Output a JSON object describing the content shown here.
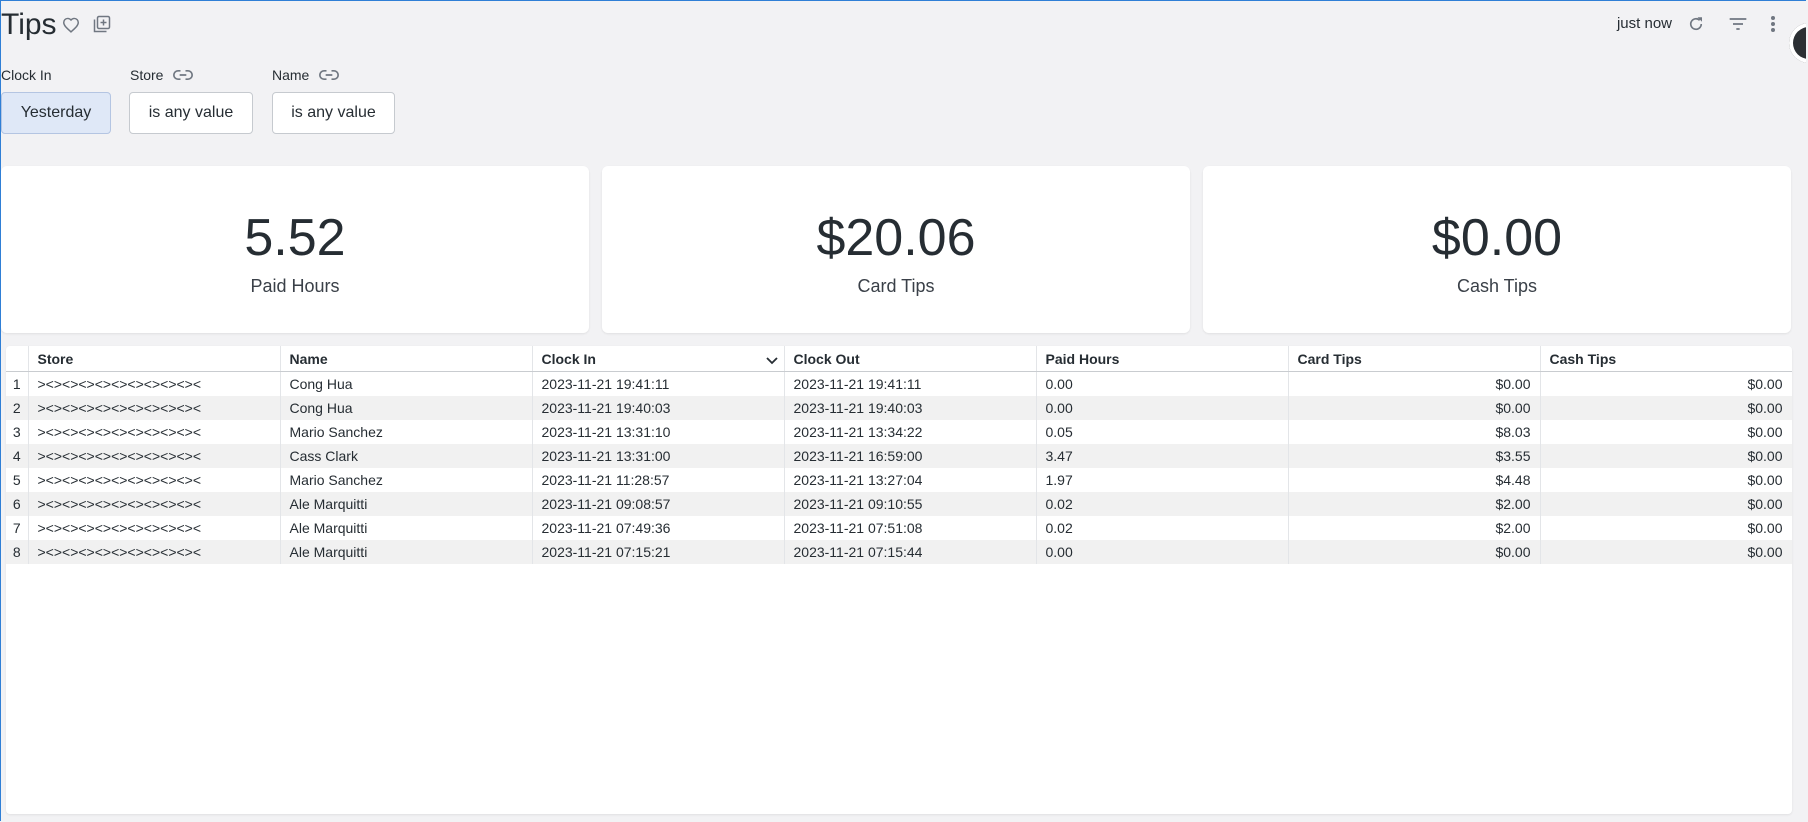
{
  "header": {
    "title": "Tips",
    "refresh_label": "just now",
    "icons": [
      "heart-icon",
      "add-to-board-icon",
      "refresh-icon",
      "filter-icon",
      "more-vert-icon"
    ]
  },
  "filters": [
    {
      "label": "Clock In",
      "value": "Yesterday",
      "linked": false
    },
    {
      "label": "Store",
      "value": "is any value",
      "linked": true
    },
    {
      "label": "Name",
      "value": "is any value",
      "linked": true
    }
  ],
  "kpis": [
    {
      "value": "5.52",
      "label": "Paid Hours"
    },
    {
      "value": "$20.06",
      "label": "Card Tips"
    },
    {
      "value": "$0.00",
      "label": "Cash Tips"
    }
  ],
  "table": {
    "columns": [
      "Store",
      "Name",
      "Clock In",
      "Clock Out",
      "Paid Hours",
      "Card Tips",
      "Cash Tips"
    ],
    "sorted_column": "Clock In",
    "rows": [
      {
        "n": "1",
        "store": "><><><><><><><><><><",
        "name": "Cong Hua",
        "clock_in": "2023-11-21 19:41:11",
        "clock_out": "2023-11-21 19:41:11",
        "paid_hours": "0.00",
        "card_tips": "$0.00",
        "cash_tips": "$0.00"
      },
      {
        "n": "2",
        "store": "><><><><><><><><><><",
        "name": "Cong Hua",
        "clock_in": "2023-11-21 19:40:03",
        "clock_out": "2023-11-21 19:40:03",
        "paid_hours": "0.00",
        "card_tips": "$0.00",
        "cash_tips": "$0.00"
      },
      {
        "n": "3",
        "store": "><><><><><><><><><><",
        "name": "Mario Sanchez",
        "clock_in": "2023-11-21 13:31:10",
        "clock_out": "2023-11-21 13:34:22",
        "paid_hours": "0.05",
        "card_tips": "$8.03",
        "cash_tips": "$0.00"
      },
      {
        "n": "4",
        "store": "><><><><><><><><><><",
        "name": "Cass Clark",
        "clock_in": "2023-11-21 13:31:00",
        "clock_out": "2023-11-21 16:59:00",
        "paid_hours": "3.47",
        "card_tips": "$3.55",
        "cash_tips": "$0.00"
      },
      {
        "n": "5",
        "store": "><><><><><><><><><><",
        "name": "Mario Sanchez",
        "clock_in": "2023-11-21 11:28:57",
        "clock_out": "2023-11-21 13:27:04",
        "paid_hours": "1.97",
        "card_tips": "$4.48",
        "cash_tips": "$0.00"
      },
      {
        "n": "6",
        "store": "><><><><><><><><><><",
        "name": "Ale Marquitti",
        "clock_in": "2023-11-21 09:08:57",
        "clock_out": "2023-11-21 09:10:55",
        "paid_hours": "0.02",
        "card_tips": "$2.00",
        "cash_tips": "$0.00"
      },
      {
        "n": "7",
        "store": "><><><><><><><><><><",
        "name": "Ale Marquitti",
        "clock_in": "2023-11-21 07:49:36",
        "clock_out": "2023-11-21 07:51:08",
        "paid_hours": "0.02",
        "card_tips": "$2.00",
        "cash_tips": "$0.00"
      },
      {
        "n": "8",
        "store": "><><><><><><><><><><",
        "name": "Ale Marquitti",
        "clock_in": "2023-11-21 07:15:21",
        "clock_out": "2023-11-21 07:15:44",
        "paid_hours": "0.00",
        "card_tips": "$0.00",
        "cash_tips": "$0.00"
      }
    ]
  }
}
